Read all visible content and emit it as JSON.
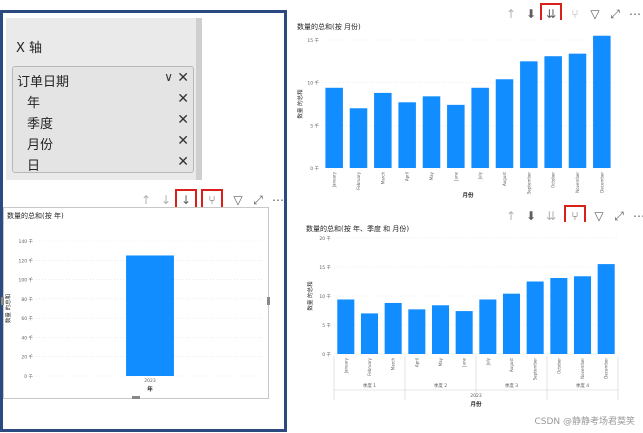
{
  "field_pane": {
    "title": "X 轴",
    "hierarchy": {
      "name": "订单日期",
      "levels": [
        "年",
        "季度",
        "月份",
        "日"
      ]
    }
  },
  "toolbar_icons": [
    "arrow-up-icon",
    "arrow-down-icon",
    "double-arrow-down-icon",
    "expand-hierarchy-icon",
    "filter-icon",
    "focus-mode-icon",
    "more-options-icon"
  ],
  "watermark": "CSDN @静静考场君莫笑",
  "colors": {
    "bar": "#118dff",
    "highlight": "#d9211c"
  },
  "chart_data": [
    {
      "id": "by-year",
      "type": "bar",
      "title": "数量的总和(按 年)",
      "xlabel": "年",
      "ylabel": "数量 的总和",
      "categories": [
        "2023"
      ],
      "values": [
        125
      ],
      "ylim": [
        0,
        140
      ],
      "yticks": [
        "0 千",
        "20 千",
        "40 千",
        "60 千",
        "80 千",
        "100 千",
        "120 千",
        "140 千"
      ]
    },
    {
      "id": "by-month",
      "type": "bar",
      "title": "数量的总和(按 月份)",
      "xlabel": "月份",
      "ylabel": "数量 的总和",
      "categories": [
        "January",
        "February",
        "March",
        "April",
        "May",
        "June",
        "July",
        "August",
        "September",
        "October",
        "November",
        "December"
      ],
      "values": [
        9.4,
        7.0,
        8.8,
        7.7,
        8.4,
        7.4,
        9.4,
        10.4,
        12.5,
        13.1,
        13.4,
        15.5
      ],
      "ylim": [
        0,
        15
      ],
      "yticks": [
        "0 千",
        "5 千",
        "10 千",
        "15 千"
      ]
    },
    {
      "id": "by-year-quarter-month",
      "type": "bar",
      "title": "数量的总和(按 年、季度 和 月份)",
      "xlabel": "月份",
      "ylabel": "数量 的总和",
      "categories": [
        "January",
        "February",
        "March",
        "April",
        "May",
        "June",
        "July",
        "August",
        "September",
        "October",
        "November",
        "December"
      ],
      "values": [
        9.4,
        7.0,
        8.8,
        7.7,
        8.4,
        7.4,
        9.4,
        10.4,
        12.5,
        13.1,
        13.4,
        15.5
      ],
      "ylim": [
        0,
        20
      ],
      "yticks": [
        "0 千",
        "5 千",
        "10 千",
        "15 千",
        "20 千"
      ],
      "quarters": [
        "季度 1",
        "季度 2",
        "季度 3",
        "季度 4"
      ],
      "year": "2023"
    }
  ]
}
